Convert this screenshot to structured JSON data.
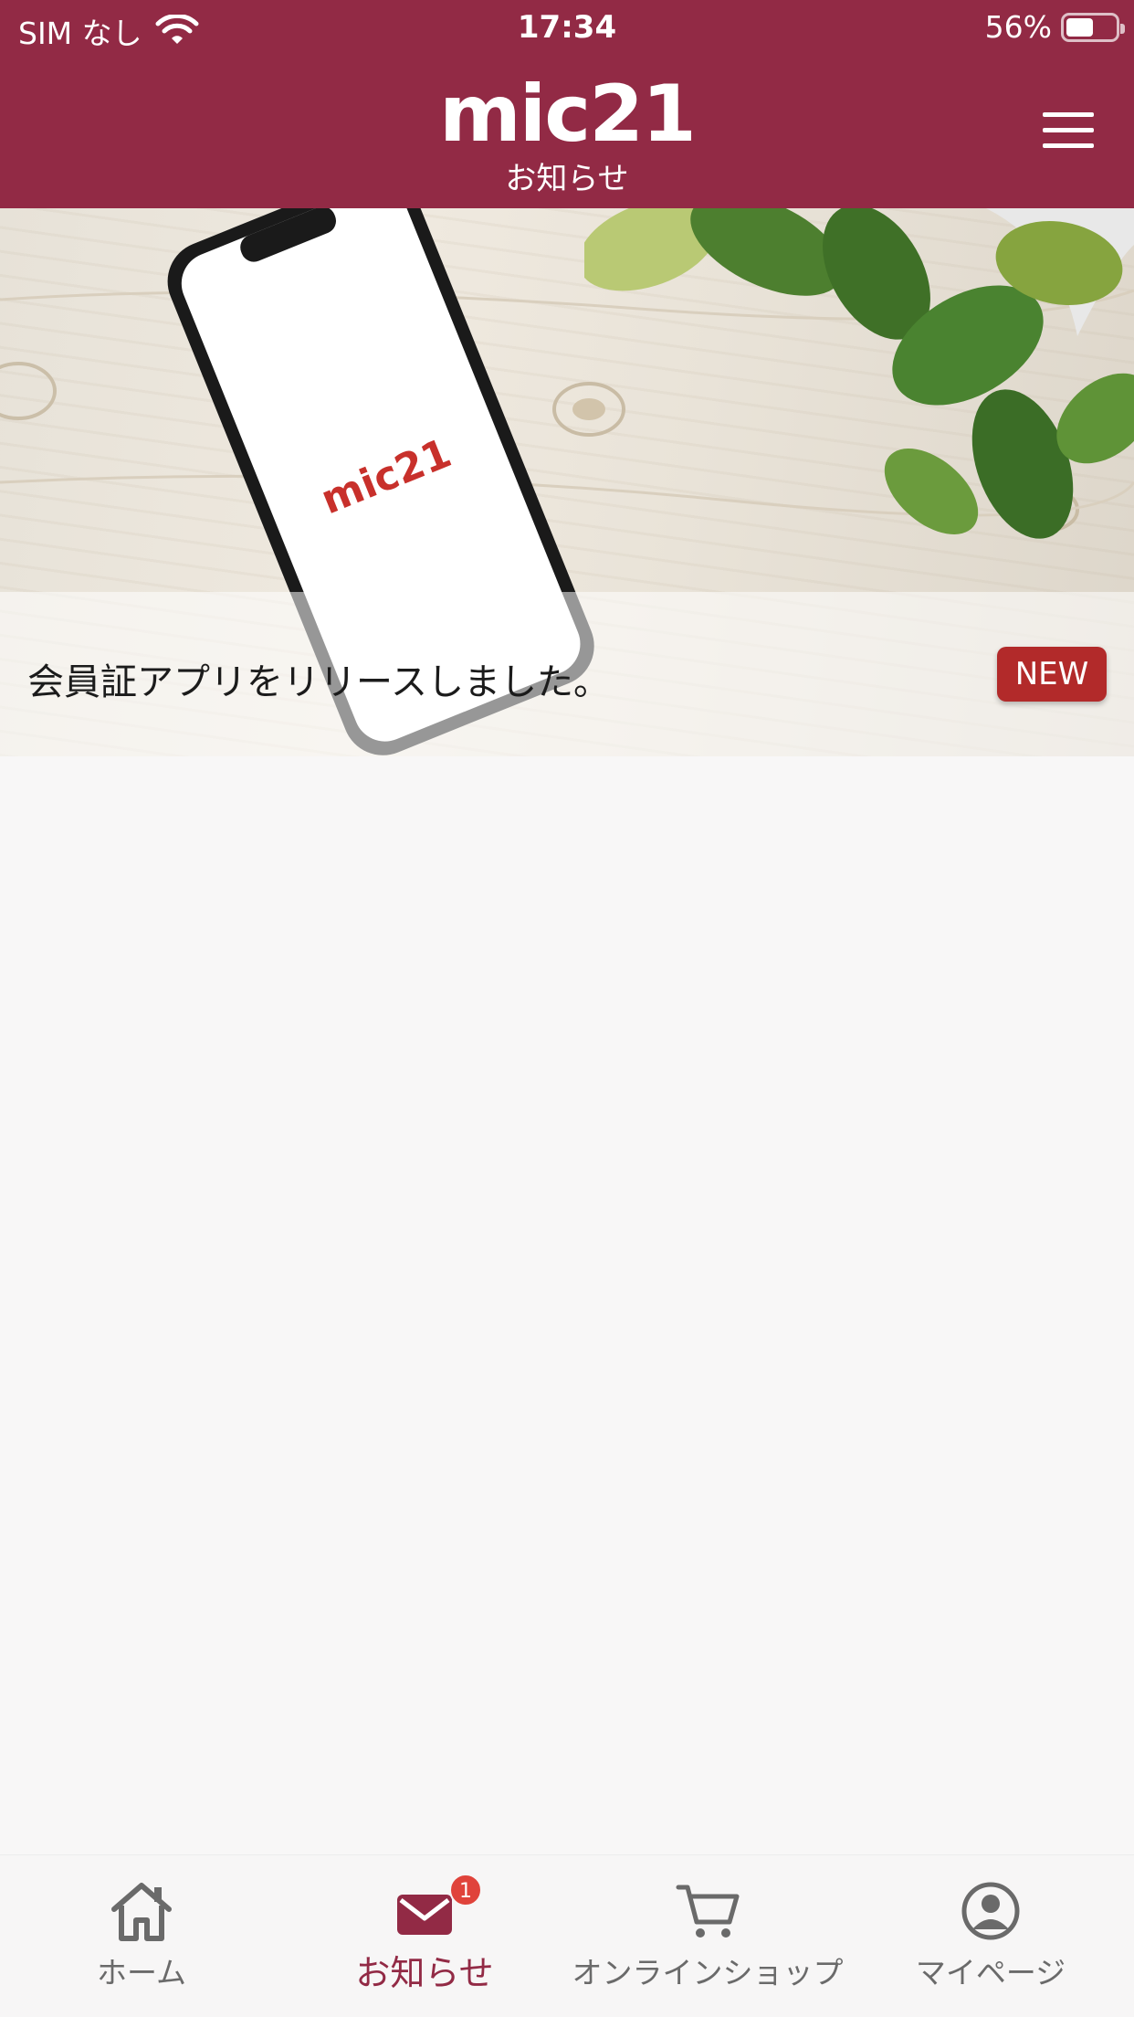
{
  "status_bar": {
    "carrier": "SIM なし",
    "time": "17:34",
    "battery_percent": "56%",
    "battery_level": 0.56
  },
  "header": {
    "logo_text": "mic21",
    "title": "お知らせ",
    "menu_icon": "hamburger-menu-icon",
    "background_color": "#922a45"
  },
  "notices": [
    {
      "title": "会員証アプリをリリースしました。",
      "badge": "NEW",
      "image_logo_text": "mic21"
    }
  ],
  "tabbar": {
    "tabs": [
      {
        "label": "ホーム",
        "icon": "home-icon",
        "active": false
      },
      {
        "label": "お知らせ",
        "icon": "mail-icon",
        "active": true,
        "badge": "1"
      },
      {
        "label": "オンラインショップ",
        "icon": "cart-icon",
        "active": false
      },
      {
        "label": "マイページ",
        "icon": "user-icon",
        "active": false
      }
    ]
  },
  "colors": {
    "accent": "#922a45",
    "badge_new": "#b22a2a",
    "badge_count": "#e0433b"
  }
}
